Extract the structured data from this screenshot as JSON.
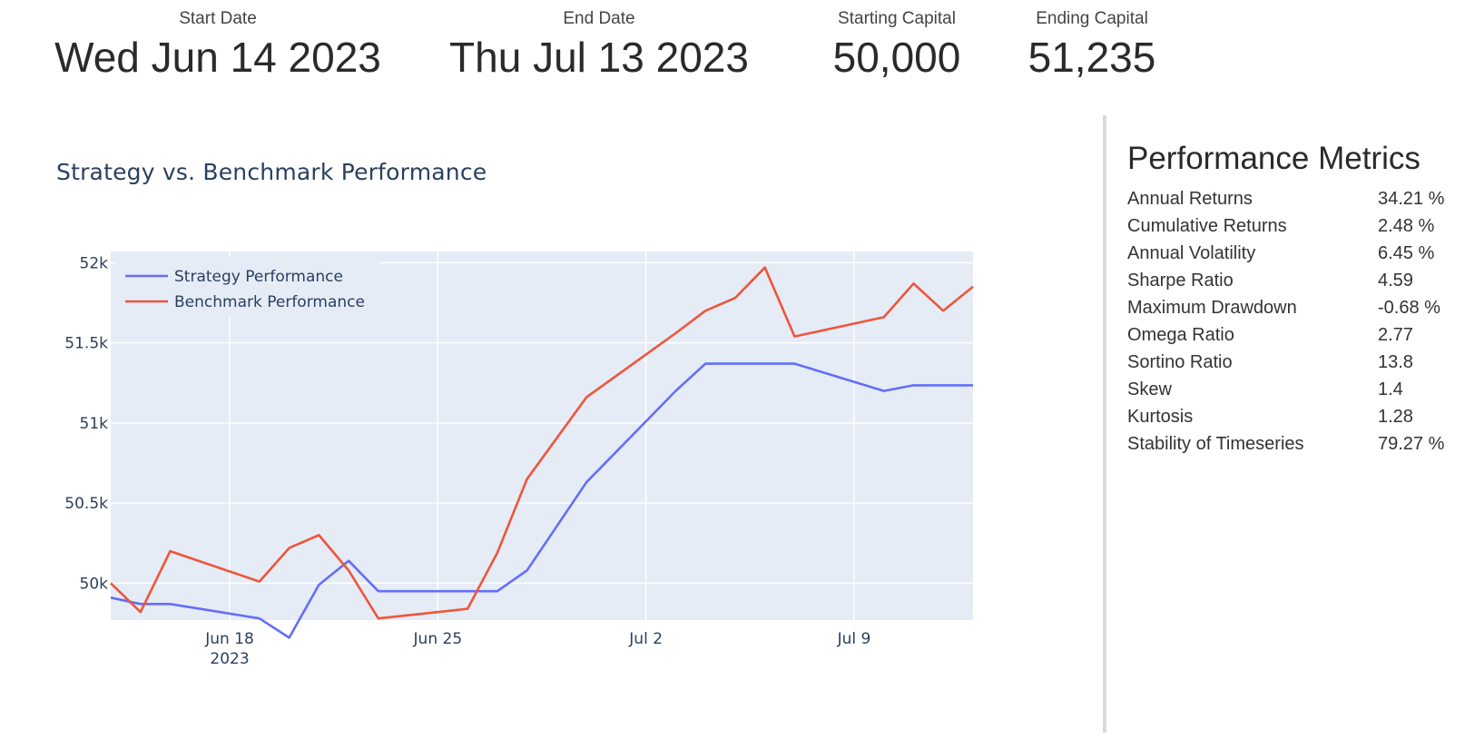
{
  "kpis": [
    {
      "label": "Start Date",
      "value": "Wed Jun 14 2023"
    },
    {
      "label": "End Date",
      "value": "Thu Jul 13 2023"
    },
    {
      "label": "Starting Capital",
      "value": "50,000"
    },
    {
      "label": "Ending Capital",
      "value": "51,235"
    }
  ],
  "metrics": {
    "title": "Performance Metrics",
    "rows": [
      {
        "name": "Annual Returns",
        "value": "34.21 %"
      },
      {
        "name": "Cumulative Returns",
        "value": "2.48 %"
      },
      {
        "name": "Annual Volatility",
        "value": "6.45 %"
      },
      {
        "name": "Sharpe Ratio",
        "value": "4.59"
      },
      {
        "name": "Maximum Drawdown",
        "value": "-0.68 %"
      },
      {
        "name": "Omega Ratio",
        "value": "2.77"
      },
      {
        "name": "Sortino Ratio",
        "value": "13.8"
      },
      {
        "name": "Skew",
        "value": "1.4"
      },
      {
        "name": "Kurtosis",
        "value": "1.28"
      },
      {
        "name": "Stability of Timeseries",
        "value": "79.27 %"
      }
    ]
  },
  "chart_data": {
    "type": "line",
    "title": "Strategy vs. Benchmark Performance",
    "xlabel": "",
    "ylabel": "",
    "xlim": [
      "2023-06-14",
      "2023-07-13"
    ],
    "ylim": [
      49770,
      52070
    ],
    "x_ticks": [
      {
        "date": "2023-06-18",
        "label": "Jun 18",
        "sublabel": "2023"
      },
      {
        "date": "2023-06-25",
        "label": "Jun 25",
        "sublabel": ""
      },
      {
        "date": "2023-07-02",
        "label": "Jul 2",
        "sublabel": ""
      },
      {
        "date": "2023-07-09",
        "label": "Jul 9",
        "sublabel": ""
      }
    ],
    "y_ticks": [
      {
        "value": 50000,
        "label": "50k"
      },
      {
        "value": 50500,
        "label": "50.5k"
      },
      {
        "value": 51000,
        "label": "51k"
      },
      {
        "value": 51500,
        "label": "51.5k"
      },
      {
        "value": 52000,
        "label": "52k"
      }
    ],
    "grid": true,
    "legend_position": "top-left",
    "plot_background": "#e5ecf6",
    "series": [
      {
        "name": "Strategy Performance",
        "color": "#636efa",
        "points": [
          [
            "2023-06-14",
            49910
          ],
          [
            "2023-06-15",
            49870
          ],
          [
            "2023-06-16",
            49870
          ],
          [
            "2023-06-19",
            49780
          ],
          [
            "2023-06-20",
            49660
          ],
          [
            "2023-06-21",
            49990
          ],
          [
            "2023-06-22",
            50140
          ],
          [
            "2023-06-23",
            49950
          ],
          [
            "2023-06-26",
            49950
          ],
          [
            "2023-06-27",
            49950
          ],
          [
            "2023-06-28",
            50080
          ],
          [
            "2023-06-30",
            50630
          ],
          [
            "2023-07-03",
            51200
          ],
          [
            "2023-07-04",
            51370
          ],
          [
            "2023-07-05",
            51370
          ],
          [
            "2023-07-06",
            51370
          ],
          [
            "2023-07-07",
            51370
          ],
          [
            "2023-07-10",
            51200
          ],
          [
            "2023-07-11",
            51235
          ],
          [
            "2023-07-12",
            51235
          ],
          [
            "2023-07-13",
            51235
          ]
        ]
      },
      {
        "name": "Benchmark Performance",
        "color": "#ef553b",
        "points": [
          [
            "2023-06-14",
            50000
          ],
          [
            "2023-06-15",
            49820
          ],
          [
            "2023-06-16",
            50200
          ],
          [
            "2023-06-19",
            50010
          ],
          [
            "2023-06-20",
            50220
          ],
          [
            "2023-06-21",
            50300
          ],
          [
            "2023-06-22",
            50080
          ],
          [
            "2023-06-23",
            49780
          ],
          [
            "2023-06-26",
            49840
          ],
          [
            "2023-06-27",
            50190
          ],
          [
            "2023-06-28",
            50650
          ],
          [
            "2023-06-30",
            51160
          ],
          [
            "2023-07-03",
            51560
          ],
          [
            "2023-07-04",
            51700
          ],
          [
            "2023-07-05",
            51780
          ],
          [
            "2023-07-06",
            51970
          ],
          [
            "2023-07-07",
            51540
          ],
          [
            "2023-07-10",
            51660
          ],
          [
            "2023-07-11",
            51870
          ],
          [
            "2023-07-12",
            51700
          ],
          [
            "2023-07-13",
            51850
          ]
        ]
      }
    ]
  }
}
